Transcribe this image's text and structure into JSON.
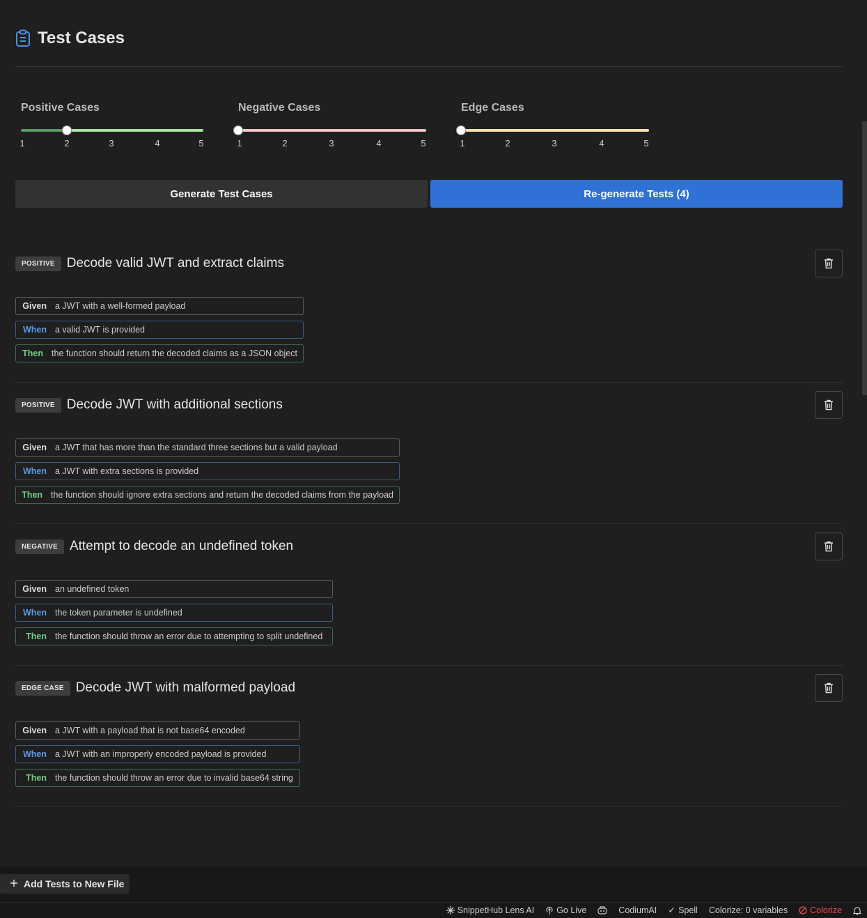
{
  "header": {
    "title": "Test Cases"
  },
  "sliders": [
    {
      "label": "Positive Cases",
      "value": 2,
      "ticks": [
        "1",
        "2",
        "3",
        "4",
        "5"
      ],
      "color": "#a6e3a1",
      "fill": "#5a9a68"
    },
    {
      "label": "Negative Cases",
      "value": 1,
      "ticks": [
        "1",
        "2",
        "3",
        "4",
        "5"
      ],
      "color": "#f5c2c7",
      "fill": "#f5c2c7"
    },
    {
      "label": "Edge Cases",
      "value": 1,
      "ticks": [
        "1",
        "2",
        "3",
        "4",
        "5"
      ],
      "color": "#f9e2af",
      "fill": "#f9e2af"
    }
  ],
  "buttons": {
    "generate": "Generate Test Cases",
    "regenerate": "Re-generate Tests (4)"
  },
  "cases": [
    {
      "badge": "POSITIVE",
      "title": "Decode valid JWT and extract claims",
      "given": "a JWT with a well-formed payload",
      "when": "a valid JWT is provided",
      "then": "the function should return the decoded claims as a JSON object"
    },
    {
      "badge": "POSITIVE",
      "title": "Decode JWT with additional sections",
      "given": "a JWT that has more than the standard three sections but a valid payload",
      "when": "a JWT with extra sections is provided",
      "then": "the function should ignore extra sections and return the decoded claims from the payload"
    },
    {
      "badge": "NEGATIVE",
      "title": "Attempt to decode an undefined token",
      "given": "an undefined token",
      "when": "the token parameter is undefined",
      "then": "the function should throw an error due to attempting to split undefined"
    },
    {
      "badge": "EDGE CASE",
      "title": "Decode JWT with malformed payload",
      "given": "a JWT with a payload that is not base64 encoded",
      "when": "a JWT with an improperly encoded payload is provided",
      "then": "the function should throw an error due to invalid base64 string"
    }
  ],
  "keywords": {
    "given": "Given",
    "when": "When",
    "then": "Then"
  },
  "add_tests_button": "Add Tests to New File",
  "status_bar": {
    "snippethub": "SnippetHub Lens AI",
    "golive": "Go Live",
    "codium": "CodiumAI",
    "spell": "Spell",
    "colorize_vars": "Colorize: 0 variables",
    "colorize": "Colorize"
  }
}
